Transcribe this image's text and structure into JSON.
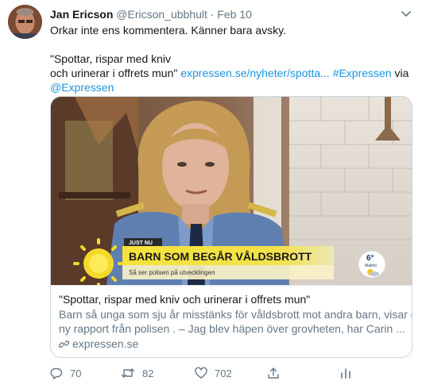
{
  "tweet": {
    "author_name": "Jan Ericson",
    "author_handle": "@Ericson_ubbhult",
    "separator": "·",
    "date": "Feb 10",
    "line1": "Orkar inte ens kommentera. Känner bara avsky.",
    "quote_line1": "\"Spottar, rispar med kniv",
    "quote_line2": "och urinerar i offrets mun\"",
    "link_url": "expressen.se/nyheter/spotta...",
    "hashtag": "#Expressen",
    "via": "via",
    "mention": "@Expressen"
  },
  "card": {
    "title": "\"Spottar, rispar med kniv och urinerar i offrets mun\"",
    "desc_line1": "Barn så unga som sju år misstänks för våldsbrott mot andra barn, visar en",
    "desc_line2": "ny rapport från polisen . – Jag blev häpen över grovheten, har Carin ...",
    "domain": "expressen.se",
    "image": {
      "tag": "JUST NU",
      "headline": "BARN SOM BEGÅR VÅLDSBROTT",
      "subline": "Så ser polisen på utvecklingen",
      "weather_temp": "6°",
      "weather_city": "Malmö"
    }
  },
  "actions": {
    "replies": "70",
    "retweets": "82",
    "likes": "702"
  },
  "colors": {
    "link": "#1b95e0",
    "muted": "#657786",
    "border": "#ccd6dd",
    "banner_yellow": "#f5e23a"
  }
}
